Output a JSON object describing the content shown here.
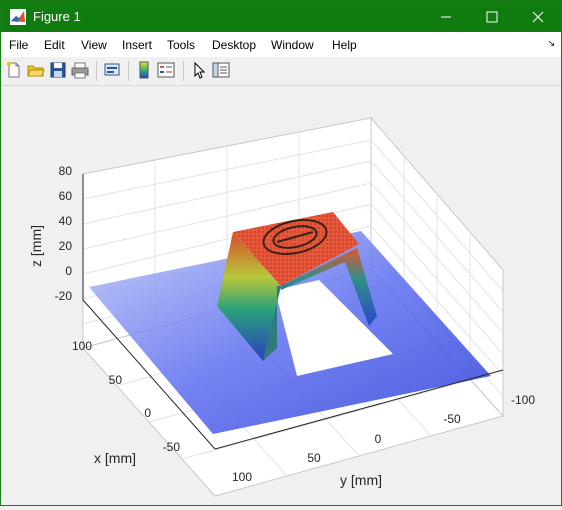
{
  "window": {
    "title": "Figure 1"
  },
  "menubar": {
    "items": [
      "File",
      "Edit",
      "View",
      "Insert",
      "Tools",
      "Desktop",
      "Window",
      "Help"
    ]
  },
  "toolbar": {
    "buttons": [
      "new-figure-icon",
      "open-file-icon",
      "save-icon",
      "print-icon",
      "print-preview-icon",
      "colorbar-icon",
      "legend-icon",
      "pointer-icon",
      "property-inspector-icon"
    ]
  },
  "plot": {
    "xlabel": "x [mm]",
    "ylabel": "y [mm]",
    "zlabel": "z [mm]",
    "x_ticks": [
      "100",
      "50",
      "0",
      "-50"
    ],
    "y_ticks": [
      "100",
      "50",
      "0",
      "-50",
      "-100"
    ],
    "z_ticks": [
      "80",
      "60",
      "40",
      "20",
      "0",
      "-20"
    ],
    "colors": {
      "surface_low": "#3b4fe0",
      "surface_mid": "#2aa198",
      "surface_high": "#e0532a",
      "title_bar": "#107c10"
    }
  }
}
